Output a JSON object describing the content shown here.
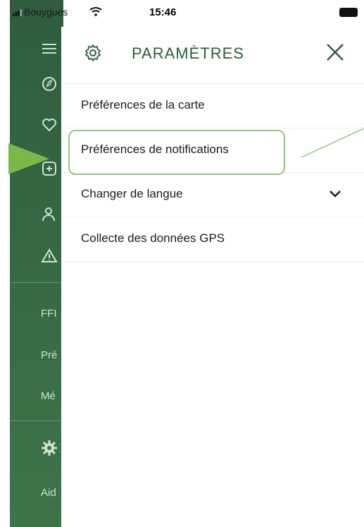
{
  "status_bar": {
    "carrier": "Bouygues",
    "time": "15:46"
  },
  "sidebar": {
    "items": [
      {
        "label": "FFI"
      },
      {
        "label": "Pré"
      },
      {
        "label": "Mé"
      },
      {
        "label": "Aid"
      }
    ]
  },
  "panel": {
    "title": "PARAMÈTRES",
    "menu": [
      {
        "label": "Préférences de la carte"
      },
      {
        "label": "Préférences de notifications"
      },
      {
        "label": "Changer de langue"
      },
      {
        "label": "Collecte des données GPS"
      }
    ]
  },
  "colors": {
    "accent": "#2b5d3c",
    "drawer": "#3d7549",
    "highlight": "#95c47f"
  }
}
